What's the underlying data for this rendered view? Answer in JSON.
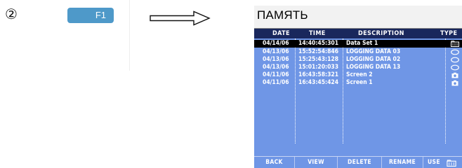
{
  "step": {
    "number": "②",
    "key_label": "F1",
    "arrow": "⟹"
  },
  "screen": {
    "title": "ПАМЯТЬ",
    "columns": [
      "DATE",
      "TIME",
      "DESCRIPTION",
      "TYPE"
    ],
    "rows": [
      {
        "date": "04/14/06",
        "time": "14:40:45:301",
        "description": "Data Set 1",
        "type_icon": "folder-icon",
        "selected": true
      },
      {
        "date": "04/13/06",
        "time": "15:52:54:846",
        "description": "LOGGING DATA 03",
        "type_icon": "logging-icon",
        "selected": false
      },
      {
        "date": "04/13/06",
        "time": "15:25:43:128",
        "description": "LOGGING DATA 02",
        "type_icon": "logging-icon",
        "selected": false
      },
      {
        "date": "04/13/06",
        "time": "15:01:20:033",
        "description": "LOGGING DATA 13",
        "type_icon": "logging-icon",
        "selected": false
      },
      {
        "date": "04/11/06",
        "time": "16:43:58:321",
        "description": "Screen 2",
        "type_icon": "camera-icon",
        "selected": false
      },
      {
        "date": "04/11/06",
        "time": "16:43:45:424",
        "description": "Screen 1",
        "type_icon": "camera-icon",
        "selected": false
      }
    ],
    "softkeys": {
      "back": "BACK",
      "view": "VIEW",
      "delete": "DELETE",
      "rename": "RENAME",
      "use": "USE"
    }
  },
  "colors": {
    "screen_bg": "#6f96e6",
    "header_bg": "#19275c",
    "selected_row": "#000000",
    "key_blue": "#4e99c9"
  }
}
